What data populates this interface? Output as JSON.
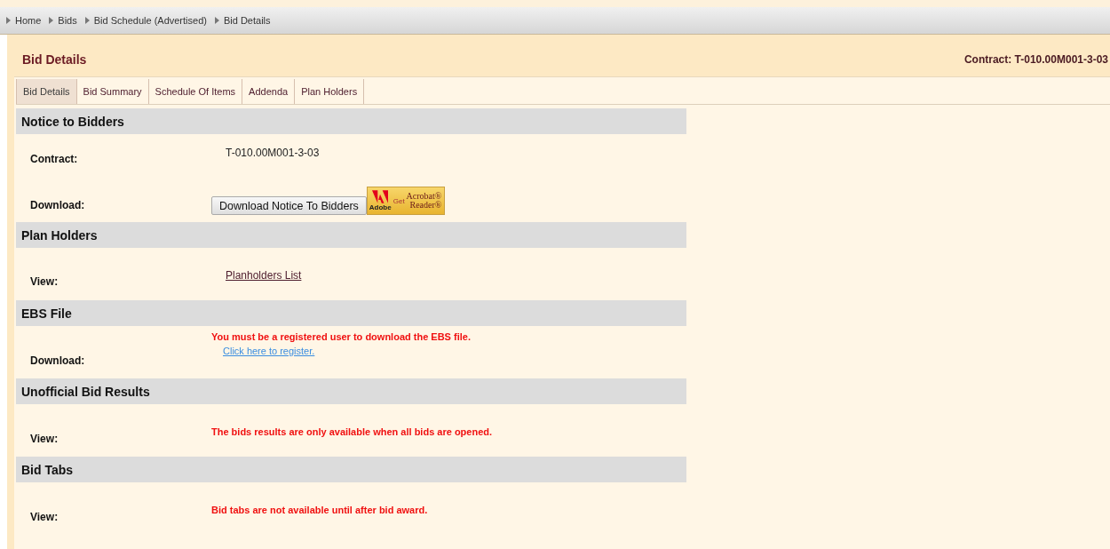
{
  "breadcrumb": [
    {
      "label": "Home"
    },
    {
      "label": "Bids"
    },
    {
      "label": "Bid Schedule (Advertised)"
    },
    {
      "label": "Bid Details"
    }
  ],
  "header": {
    "title": "Bid Details",
    "contract": "Contract: T-010.00M001-3-03"
  },
  "tabs": [
    {
      "label": "Bid Details",
      "selected": true
    },
    {
      "label": "Bid Summary",
      "selected": false
    },
    {
      "label": "Schedule Of Items",
      "selected": false
    },
    {
      "label": "Addenda",
      "selected": false
    },
    {
      "label": "Plan Holders",
      "selected": false
    }
  ],
  "sections": [
    {
      "title": "Notice to Bidders",
      "rows": [
        {
          "label": "Contract:",
          "items": [
            {
              "kind": "text",
              "text": "T-010.00M001-3-03"
            }
          ]
        },
        {
          "label": "Download:",
          "items": [
            {
              "kind": "button",
              "text": "Download Notice To Bidders"
            },
            {
              "kind": "acrobat",
              "get": "Get",
              "product": "Acrobat®",
              "reader": "Reader®",
              "brand": "Adobe"
            }
          ]
        }
      ]
    },
    {
      "title": "Plan Holders",
      "rows": [
        {
          "label": "View:",
          "items": [
            {
              "kind": "link",
              "text": "Planholders List"
            }
          ]
        }
      ]
    },
    {
      "title": "EBS File",
      "rows": [
        {
          "label": "Download:",
          "items": [
            {
              "kind": "notice",
              "text": "You must be a registered user to download the EBS file."
            },
            {
              "kind": "register",
              "text": "Click here to register."
            }
          ]
        }
      ]
    },
    {
      "title": "Unofficial Bid Results",
      "rows": [
        {
          "label": "View:",
          "items": [
            {
              "kind": "notice",
              "text": "The bids results are only available when all bids are opened."
            }
          ]
        }
      ]
    },
    {
      "title": "Bid Tabs",
      "rows": [
        {
          "label": "View:",
          "items": [
            {
              "kind": "notice",
              "text": "Bid tabs are not available until after bid award."
            }
          ]
        }
      ]
    }
  ]
}
